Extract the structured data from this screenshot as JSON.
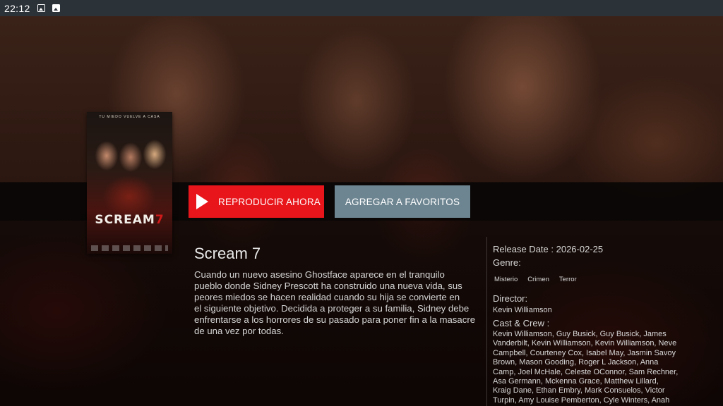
{
  "status_bar": {
    "time": "22:12",
    "icons": [
      "image-icon",
      "image-alt-icon"
    ]
  },
  "poster": {
    "tagline": "TU MIEDO VUELVE A CASA",
    "title_main": "SCREAM",
    "title_number": "7"
  },
  "actions": {
    "play_label": "REPRODUCIR AHORA",
    "favorites_label": "AGREGAR A FAVORITOS"
  },
  "movie": {
    "title": "Scream 7",
    "synopsis_lines": [
      "Cuando un nuevo asesino Ghostface aparece en el tranquilo",
      "pueblo donde Sidney Prescott ha construido una nueva vida, sus",
      "peores miedos se hacen realidad cuando su hija se convierte en",
      "el siguiente objetivo. Decidida a proteger a su familia, Sidney debe",
      "enfrentarse a los horrores de su pasado para poner fin a la masacre",
      "de una vez por todas."
    ]
  },
  "details": {
    "release_date": "Release Date : 2026-02-25",
    "genre_label": "Genre:",
    "genres": [
      "Misterio",
      "Crimen",
      "Terror"
    ],
    "director_label": "Director:",
    "director": "Kevin Williamson",
    "cast_label": "Cast & Crew :",
    "cast_lines": [
      "Kevin Williamson, Guy Busick, Guy Busick, James",
      "Vanderbilt, Kevin Williamson, Kevin Williamson, Neve",
      "Campbell, Courteney Cox, Isabel May, Jasmin Savoy",
      "Brown, Mason Gooding, Roger L Jackson, Anna",
      "Camp, Joel McHale, Celeste OConnor, Sam Rechner,",
      "Asa Germann, Mckenna Grace, Matthew Lillard,",
      "Kraig Dane, Ethan Embry, Mark Consuelos, Victor",
      "Turpin, Amy Louise Pemberton, Cyle Winters, Anah"
    ]
  },
  "colors": {
    "play_button": "#e8151b",
    "favorites_button": "#6d8591",
    "status_bar": "#2b3238"
  }
}
